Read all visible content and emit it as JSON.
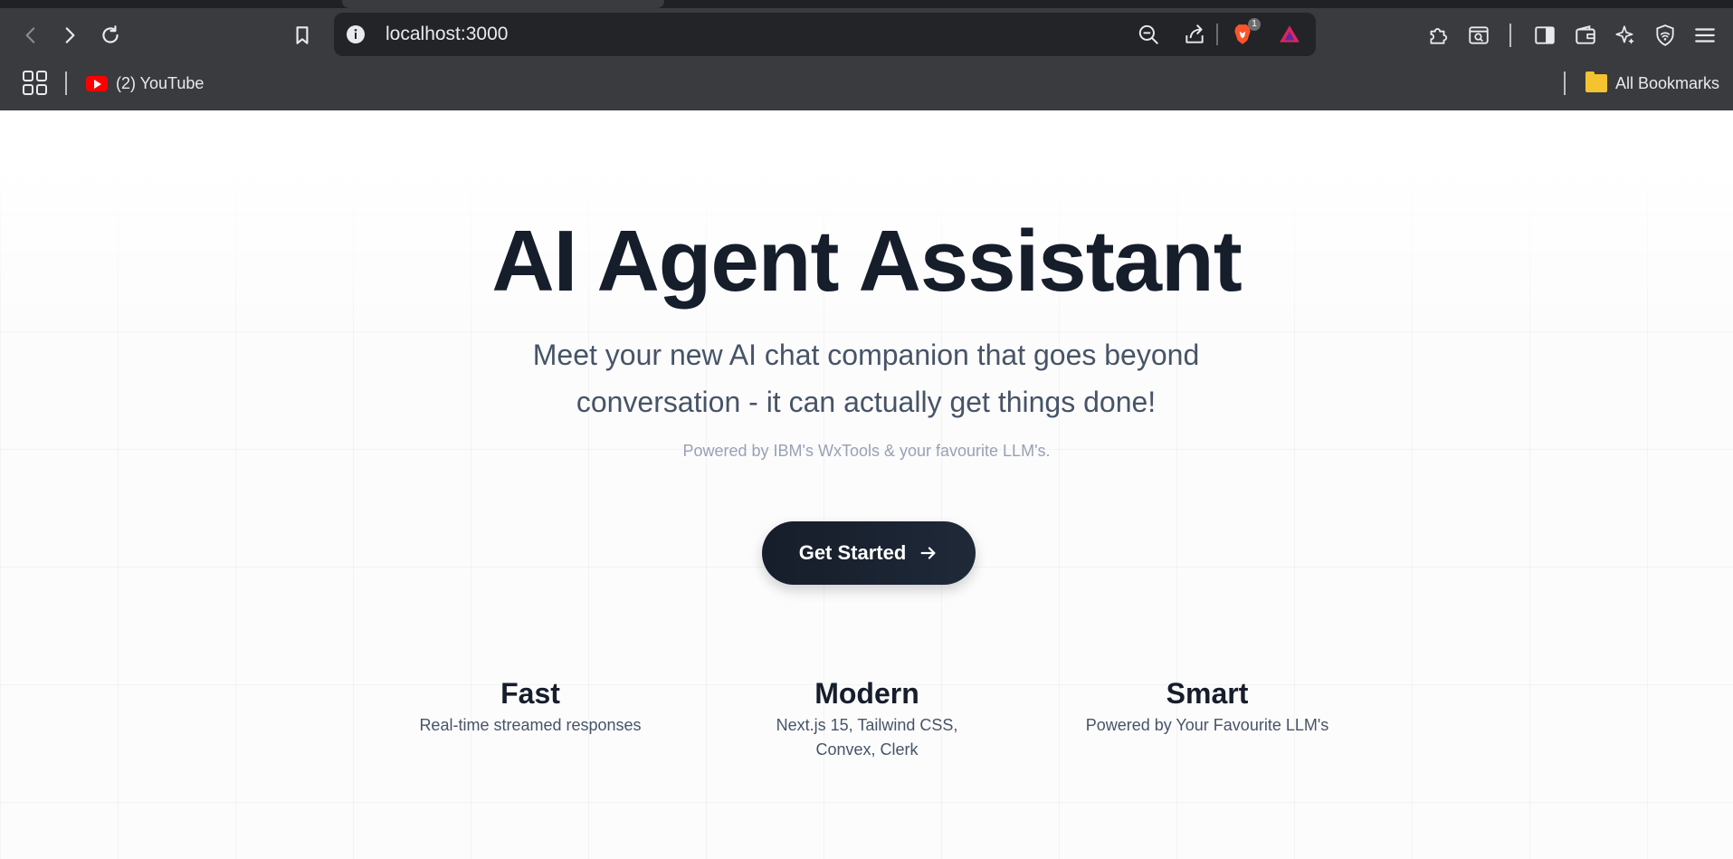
{
  "browser": {
    "url": "localhost:3000",
    "brave_badge_count": "1",
    "bookmarks": [
      {
        "label": "(2) YouTube",
        "icon": "youtube-icon"
      }
    ],
    "all_bookmarks_label": "All Bookmarks"
  },
  "hero": {
    "title": "AI Agent Assistant",
    "subtitle": "Meet your new AI chat companion that goes beyond conversation - it can actually get things done!",
    "powered_by": "Powered by IBM's WxTools & your favourite LLM's.",
    "cta_label": "Get Started"
  },
  "features": [
    {
      "title": "Fast",
      "description": "Real-time streamed responses"
    },
    {
      "title": "Modern",
      "description": "Next.js 15, Tailwind CSS, Convex, Clerk"
    },
    {
      "title": "Smart",
      "description": "Powered by Your Favourite LLM's"
    }
  ],
  "colors": {
    "chrome_bg": "#3a3b3e",
    "omnibox_bg": "#232427",
    "heading": "#161d2b",
    "body_text": "#475467",
    "muted_text": "#98a2b3",
    "cta_bg": "#161d2b",
    "brave_orange": "#fb542b"
  }
}
